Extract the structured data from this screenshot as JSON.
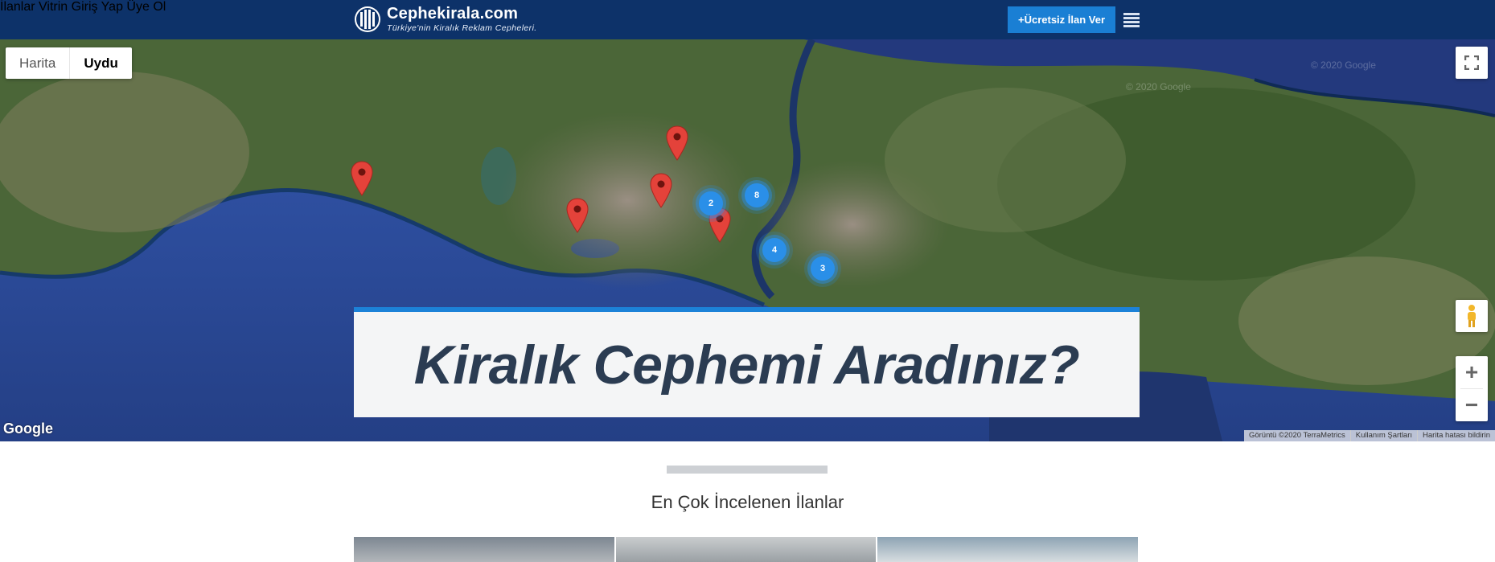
{
  "header": {
    "logo_title": "Cephekirala.com",
    "logo_tagline": "Türkiye'nin Kiralık Reklam Cepheleri.",
    "nav": [
      {
        "label": "İlanlar Vitrin"
      },
      {
        "label": "Giriş Yap"
      },
      {
        "label": "Üye Ol"
      }
    ],
    "cta_label": "+Ücretsiz İlan Ver",
    "menu_icon": "hamburger-icon"
  },
  "map": {
    "type_options": [
      {
        "label": "Harita",
        "selected": false
      },
      {
        "label": "Uydu",
        "selected": true
      }
    ],
    "clusters": [
      {
        "count": "2"
      },
      {
        "count": "8"
      },
      {
        "count": "4"
      },
      {
        "count": "3"
      }
    ],
    "marker_count": 5,
    "google_logo": "Google",
    "attribution": [
      "Görüntü ©2020 TerraMetrics",
      "Kullanım Şartları",
      "Harita hatası bildirin"
    ],
    "colors": {
      "land": "#3f5a34",
      "sea": "#2d4a9a",
      "marker": "#e4423a",
      "cluster": "#2a8fe8"
    }
  },
  "hero": {
    "title": "Kiralık Cephemi Aradınız?",
    "accent": "#1c82d8"
  },
  "section": {
    "title": "En Çok İncelenen İlanlar"
  },
  "colors": {
    "header_bg": "#0d3269",
    "cta_bg": "#1a7fd4"
  }
}
